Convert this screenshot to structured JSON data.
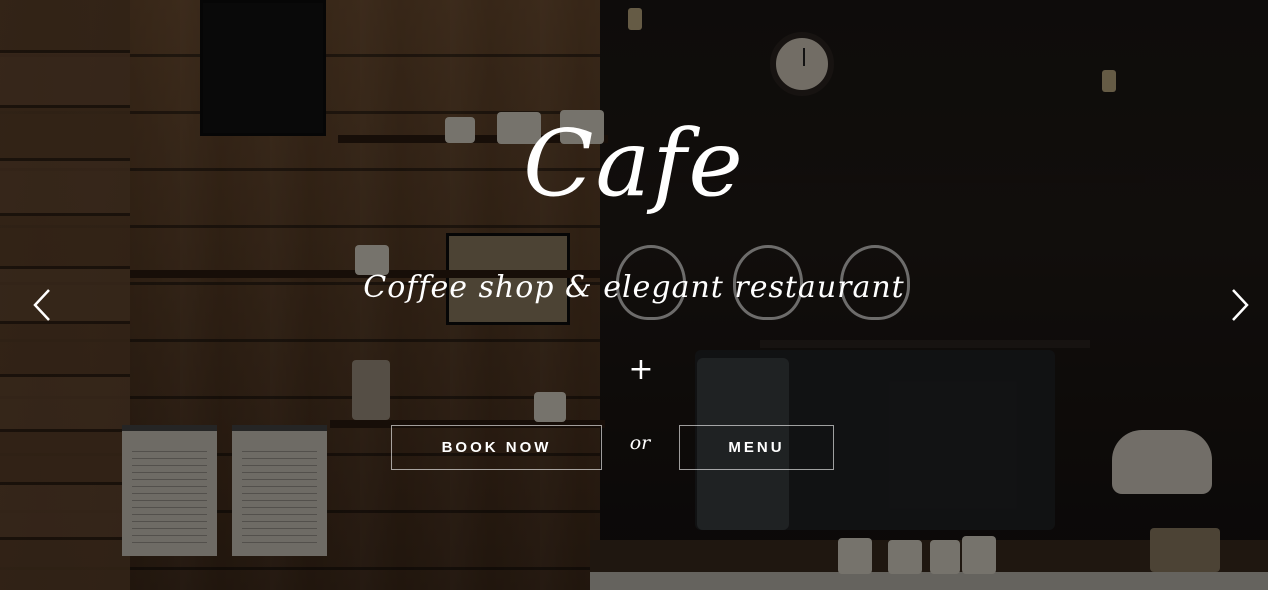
{
  "hero": {
    "title": "Cafe",
    "subtitle": "Coffee shop & elegant restaurant",
    "divider_symbol": "+",
    "separator_text": "or"
  },
  "buttons": {
    "book_label": "BOOK NOW",
    "menu_label": "MENU"
  },
  "carousel": {
    "prev_icon": "chevron-left-icon",
    "next_icon": "chevron-right-icon"
  },
  "colors": {
    "text": "#ffffff",
    "button_border": "rgba(255,255,255,0.6)",
    "overlay": "rgba(0,0,0,0.45)"
  }
}
